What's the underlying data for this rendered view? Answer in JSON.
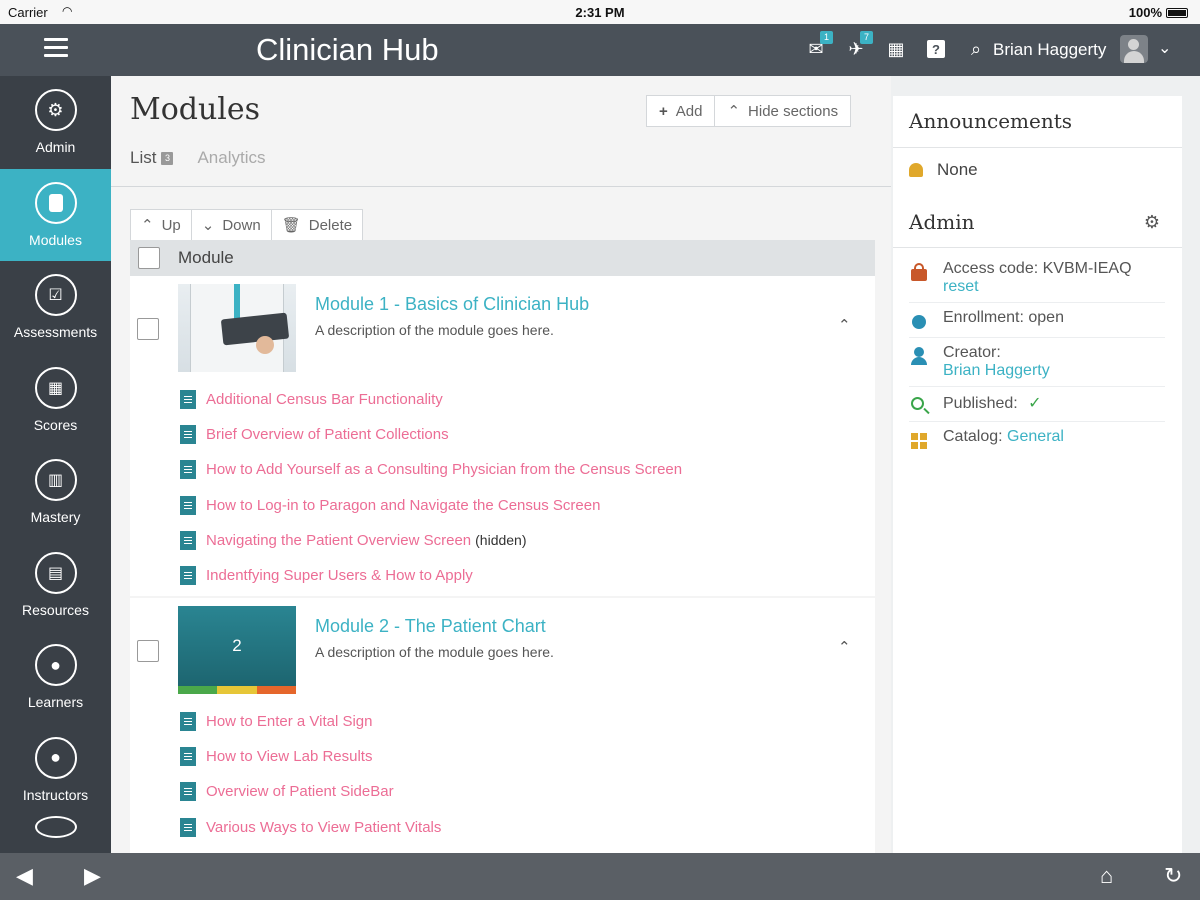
{
  "status_bar": {
    "carrier": "Carrier",
    "time": "2:31 PM",
    "battery": "100%"
  },
  "header": {
    "title": "Clinician Hub",
    "user_name": "Brian Haggerty",
    "icons": [
      {
        "name": "inbox-icon",
        "glyph": "✉",
        "badge": "1"
      },
      {
        "name": "alerts-icon",
        "glyph": "✈",
        "badge": "7"
      },
      {
        "name": "calendar-icon",
        "glyph": "▦",
        "badge": ""
      }
    ],
    "help_glyph": "?",
    "search_glyph": "⌕"
  },
  "sidebar": {
    "items": [
      {
        "key": "admin",
        "label": "Admin",
        "active": false
      },
      {
        "key": "modules",
        "label": "Modules",
        "active": true
      },
      {
        "key": "assessments",
        "label": "Assessments",
        "active": false
      },
      {
        "key": "scores",
        "label": "Scores",
        "active": false
      },
      {
        "key": "mastery",
        "label": "Mastery",
        "active": false
      },
      {
        "key": "resources",
        "label": "Resources",
        "active": false
      },
      {
        "key": "learners",
        "label": "Learners",
        "active": false
      },
      {
        "key": "instructors",
        "label": "Instructors",
        "active": false
      }
    ]
  },
  "main": {
    "title": "Modules",
    "actions": {
      "add": "Add",
      "hide_sections": "Hide sections"
    },
    "tabs": [
      {
        "label": "List",
        "badge": "3",
        "active": true
      },
      {
        "label": "Analytics",
        "active": false
      }
    ],
    "toolbar": {
      "up": "Up",
      "down": "Down",
      "delete": "Delete"
    },
    "column_header": "Module",
    "modules": [
      {
        "title": "Module 1 - Basics of Clinician Hub",
        "description": "A description of the module goes here.",
        "lessons": [
          {
            "title": "Additional Census Bar Functionality",
            "note": ""
          },
          {
            "title": "Brief Overview of Patient Collections",
            "note": ""
          },
          {
            "title": "How to Add Yourself as a Consulting Physician from the Census Screen",
            "note": ""
          },
          {
            "title": "How to Log-in to Paragon and Navigate the Census Screen",
            "note": ""
          },
          {
            "title": "Navigating the Patient Overview Screen",
            "note": "(hidden)"
          },
          {
            "title": "Indentfying Super Users & How to Apply",
            "note": ""
          }
        ]
      },
      {
        "title": "Module 2 - The Patient Chart",
        "description": "A description of the module goes here.",
        "thumb_number": "2",
        "lessons": [
          {
            "title": "How to Enter a Vital Sign",
            "note": ""
          },
          {
            "title": "How to View Lab Results",
            "note": ""
          },
          {
            "title": "Overview of Patient SideBar",
            "note": ""
          },
          {
            "title": "Various Ways to View Patient Vitals",
            "note": ""
          }
        ]
      }
    ]
  },
  "right_panel": {
    "announcements_title": "Announcements",
    "announcements_value": "None",
    "admin_title": "Admin",
    "access_code_label": "Access code: KVBM-IEAQ",
    "access_code_reset": "reset",
    "enrollment": "Enrollment: open",
    "creator_label": "Creator:",
    "creator_name": "Brian Haggerty",
    "published_label": "Published:",
    "published_mark": "✓",
    "catalog_label": "Catalog:",
    "catalog_value": "General"
  },
  "colors": {
    "accent": "#3cb2c4",
    "lesson_link": "#ec6d95",
    "header_bg": "#4a5159",
    "sidebar_bg": "#3a4047",
    "book_stripe": [
      "#4aa84a",
      "#e6c637",
      "#e5662b"
    ]
  }
}
